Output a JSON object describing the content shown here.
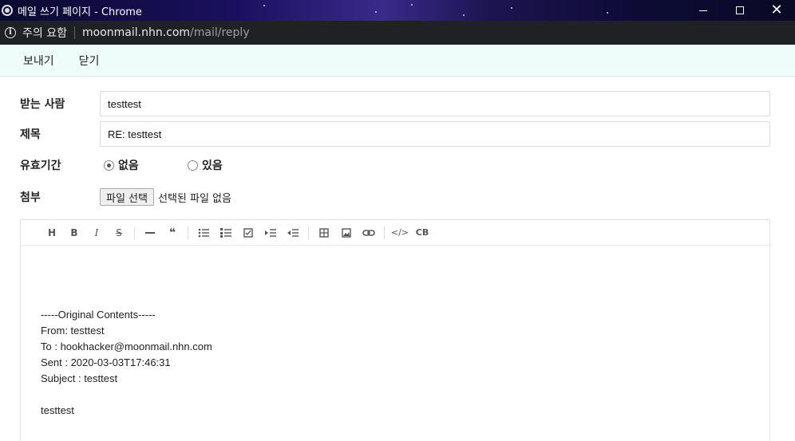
{
  "window": {
    "title": "메일 쓰기 페이지 - Chrome",
    "icon": "chrome-icon"
  },
  "address": {
    "security_label": "주의 요함",
    "url_host": "moonmail.nhn.com",
    "url_path": "/mail/reply"
  },
  "toolbar": {
    "send_label": "보내기",
    "close_label": "닫기"
  },
  "form": {
    "to_label": "받는 사람",
    "to_value": "testtest",
    "subject_label": "제목",
    "subject_value": "RE: testtest",
    "expiry_label": "유효기간",
    "expiry_options": [
      {
        "label": "없음",
        "checked": true
      },
      {
        "label": "있음",
        "checked": false
      }
    ],
    "attach_label": "첨부",
    "file_button_label": "파일 선택",
    "file_status": "선택된 파일 없음"
  },
  "editor": {
    "toolbar_icons": [
      "heading-icon",
      "bold-icon",
      "italic-icon",
      "strike-icon",
      "hr-icon",
      "quote-icon",
      "bullet-list-icon",
      "ordered-list-icon",
      "task-list-icon",
      "indent-icon",
      "outdent-icon",
      "table-icon",
      "image-icon",
      "link-icon",
      "code-icon",
      "codeblock-icon"
    ],
    "toolbar_glyphs": {
      "heading": "H",
      "bold": "B",
      "italic": "I",
      "strike": "S",
      "quote": "❝",
      "codeblock": "CB",
      "code": "</>"
    },
    "body_lines": [
      "-----Original Contents-----",
      "From: testtest",
      "To : hookhacker@moonmail.nhn.com",
      "Sent : 2020-03-03T17:46:31",
      "Subject : testtest",
      "",
      "testtest"
    ]
  }
}
